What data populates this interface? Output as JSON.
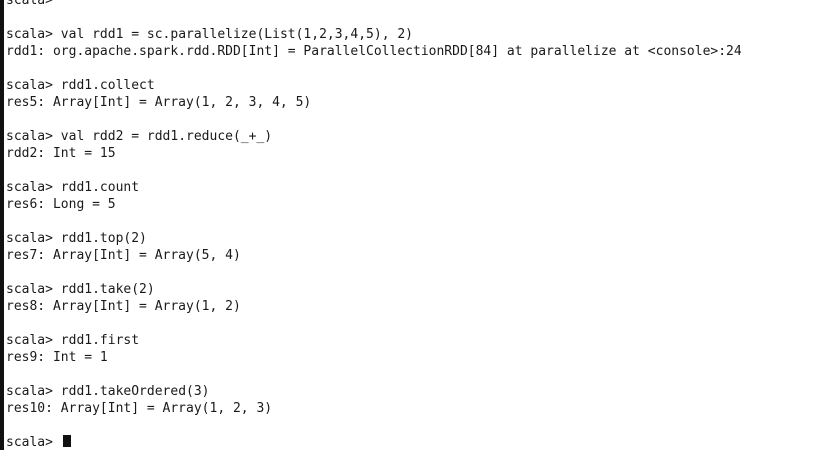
{
  "terminal": {
    "prompt": "scala>",
    "lines": [
      {
        "type": "prompt",
        "command": ""
      },
      {
        "type": "blank",
        "text": ""
      },
      {
        "type": "prompt",
        "command": "val rdd1 = sc.parallelize(List(1,2,3,4,5), 2)"
      },
      {
        "type": "output",
        "text": "rdd1: org.apache.spark.rdd.RDD[Int] = ParallelCollectionRDD[84] at parallelize at <console>:24"
      },
      {
        "type": "blank",
        "text": ""
      },
      {
        "type": "prompt",
        "command": "rdd1.collect"
      },
      {
        "type": "output",
        "text": "res5: Array[Int] = Array(1, 2, 3, 4, 5)"
      },
      {
        "type": "blank",
        "text": ""
      },
      {
        "type": "prompt",
        "command": "val rdd2 = rdd1.reduce(_+_)"
      },
      {
        "type": "output",
        "text": "rdd2: Int = 15"
      },
      {
        "type": "blank",
        "text": ""
      },
      {
        "type": "prompt",
        "command": "rdd1.count"
      },
      {
        "type": "output",
        "text": "res6: Long = 5"
      },
      {
        "type": "blank",
        "text": ""
      },
      {
        "type": "prompt",
        "command": "rdd1.top(2)"
      },
      {
        "type": "output",
        "text": "res7: Array[Int] = Array(5, 4)"
      },
      {
        "type": "blank",
        "text": ""
      },
      {
        "type": "prompt",
        "command": "rdd1.take(2)"
      },
      {
        "type": "output",
        "text": "res8: Array[Int] = Array(1, 2)"
      },
      {
        "type": "blank",
        "text": ""
      },
      {
        "type": "prompt",
        "command": "rdd1.first"
      },
      {
        "type": "output",
        "text": "res9: Int = 1"
      },
      {
        "type": "blank",
        "text": ""
      },
      {
        "type": "prompt",
        "command": "rdd1.takeOrdered(3)"
      },
      {
        "type": "output",
        "text": "res10: Array[Int] = Array(1, 2, 3)"
      },
      {
        "type": "blank",
        "text": ""
      },
      {
        "type": "prompt",
        "command": "",
        "cursor": true
      }
    ]
  }
}
